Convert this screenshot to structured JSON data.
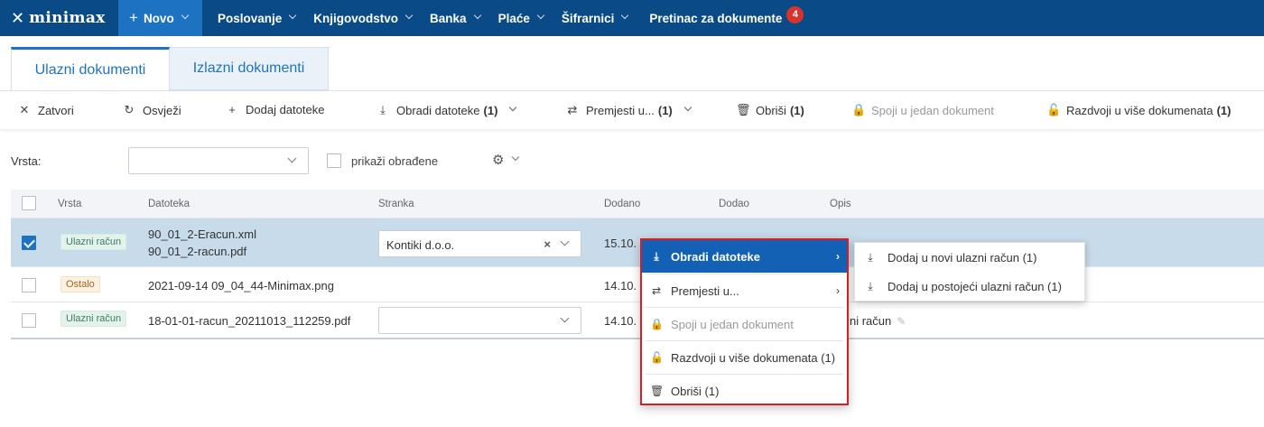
{
  "topnav": {
    "logo": "minimax",
    "new_label": "Novo",
    "items": [
      {
        "label": "Poslovanje"
      },
      {
        "label": "Knjigovodstvo"
      },
      {
        "label": "Banka"
      },
      {
        "label": "Plaće"
      },
      {
        "label": "Šifrarnici"
      }
    ],
    "inbox_label": "Pretinac za dokumente",
    "inbox_badge": "4"
  },
  "tabs": {
    "active": "Ulazni dokumenti",
    "inactive": "Izlazni dokumenti"
  },
  "toolbar": {
    "close": "Zatvori",
    "refresh": "Osvježi",
    "add_files": "Dodaj datoteke",
    "process_files": "Obradi datoteke",
    "process_count": "(1)",
    "move_to": "Premjesti u...",
    "move_count": "(1)",
    "delete": "Obriši",
    "delete_count": "(1)",
    "merge": "Spoji u jedan dokument",
    "split": "Razdvoji u više dokumenata",
    "split_count": "(1)"
  },
  "filter": {
    "type_label": "Vrsta:",
    "type_value": "",
    "show_processed_label": "prikaži obrađene"
  },
  "table": {
    "headers": {
      "type": "Vrsta",
      "file": "Datoteka",
      "party": "Stranka",
      "added": "Dodano",
      "added_by": "Dodao",
      "description": "Opis"
    },
    "rows": [
      {
        "selected": true,
        "type": "Ulazni račun",
        "file_line1": "90_01_2-Eracun.xml",
        "file_line2": "90_01_2-racun.pdf",
        "party": "Kontiki d.o.o.",
        "added": "15.10."
      },
      {
        "selected": false,
        "type": "Ostalo",
        "file_line1": "2021-09-14 09_04_44-Minimax.png",
        "party": "",
        "added": "14.10."
      },
      {
        "selected": false,
        "type": "Ulazni račun",
        "file_line1": "18-01-01-racun_20211013_112259.pdf",
        "party": "",
        "added": "14.10.",
        "description_partial": "ni račun"
      }
    ]
  },
  "context_menu": {
    "items": [
      {
        "label": "Obradi datoteke",
        "highlighted": true,
        "has_submenu": true
      },
      {
        "label": "Premjesti u...",
        "has_submenu": true
      },
      {
        "label": "Spoji u jedan dokument",
        "disabled": true
      },
      {
        "label": "Razdvoji u više dokumenata (1)"
      },
      {
        "label": "Obriši (1)"
      }
    ]
  },
  "submenu": {
    "items": [
      {
        "label": "Dodaj u novi ulazni račun (1)"
      },
      {
        "label": "Dodaj u postojeći ulazni račun (1)"
      }
    ]
  },
  "colors": {
    "nav_bg": "#0a4a86",
    "accent": "#1e72c2",
    "selected_row": "#c7dbea",
    "badge": "#d9342b",
    "menu_border": "#d61f26"
  }
}
